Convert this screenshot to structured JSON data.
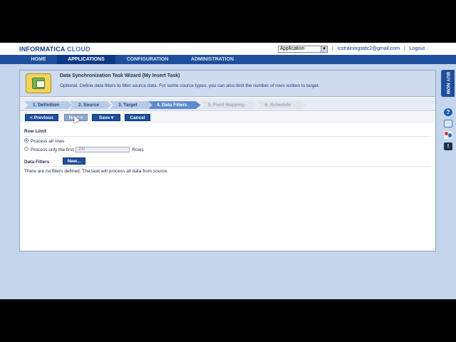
{
  "header": {
    "logo_brand": "INFORMATICA",
    "logo_product": "CLOUD",
    "app_select_value": "Application",
    "user_email": "icstrainingstdc2@gmail.com",
    "logout_label": "Logout",
    "separator": "|"
  },
  "nav": {
    "tabs": [
      {
        "label": "HOME"
      },
      {
        "label": "APPLICATIONS"
      },
      {
        "label": "CONFIGURATION"
      },
      {
        "label": "ADMINISTRATION"
      }
    ],
    "active_tab": "APPLICATIONS"
  },
  "wizard": {
    "title": "Data Synchronization Task Wizard (My Insert Task)",
    "description": "Optional. Define data filters to filter source data. For some source types, you can also limit the number of rows written to target.",
    "steps": [
      {
        "label": "1. Definition",
        "state": "done"
      },
      {
        "label": "2. Source",
        "state": "done"
      },
      {
        "label": "3. Target",
        "state": "done"
      },
      {
        "label": "4. Data Filters",
        "state": "current"
      },
      {
        "label": "5. Field Mapping",
        "state": "future"
      },
      {
        "label": "6. Schedule",
        "state": "future"
      }
    ]
  },
  "toolbar": {
    "previous_label": "< Previous",
    "next_label": "Next >",
    "save_label": "Save ▾",
    "cancel_label": "Cancel"
  },
  "row_limit": {
    "heading": "Row Limit",
    "option_all": "Process all rows",
    "option_first": "Process only the first",
    "rows_value": "100",
    "rows_suffix": "Rows",
    "selected": "all"
  },
  "data_filters": {
    "heading": "Data Filters",
    "new_label": "New...",
    "empty_message": "There are no filters defined. The task will process all data from source."
  },
  "side": {
    "buy_now_label": "BUY NOW",
    "help_glyph": "?",
    "alert_glyph": "!"
  },
  "colors": {
    "accent": "#1e4f9c",
    "background": "#c5d6ec",
    "header_band": "#cfdcef",
    "step_current": "#5f8bd0"
  }
}
